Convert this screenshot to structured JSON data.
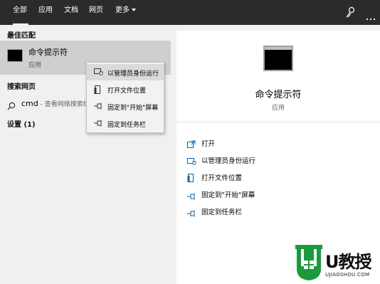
{
  "tabs": {
    "all": "全部",
    "apps": "应用",
    "docs": "文档",
    "web": "网页",
    "more": "更多"
  },
  "left": {
    "best_match_title": "最佳匹配",
    "best_match": {
      "name": "命令提示符",
      "type": "应用",
      "icon": "command-prompt-icon"
    },
    "web_title": "搜索网页",
    "web_query": "cmd",
    "web_hint": " - 查看网络搜索结",
    "settings_title": "设置 (1)"
  },
  "context_menu": [
    {
      "label": "以管理员身份运行",
      "icon": "shield-icon"
    },
    {
      "label": "打开文件位置",
      "icon": "file-location-icon"
    },
    {
      "label": "固定到\"开始\"屏幕",
      "icon": "pin-icon"
    },
    {
      "label": "固定到任务栏",
      "icon": "pin-icon"
    }
  ],
  "right": {
    "name": "命令提示符",
    "type": "应用",
    "actions": [
      {
        "label": "打开",
        "icon": "open-icon"
      },
      {
        "label": "以管理员身份运行",
        "icon": "shield-icon"
      },
      {
        "label": "打开文件位置",
        "icon": "file-location-icon"
      },
      {
        "label": "固定到\"开始\"屏幕",
        "icon": "pin-icon"
      },
      {
        "label": "固定到任务栏",
        "icon": "pin-icon"
      }
    ]
  },
  "watermark": {
    "brand": "U教授",
    "url": "UJIAOSHOU.COM"
  },
  "colors": {
    "topbar": "#2b2b2b",
    "accent": "#0063b1",
    "selection": "#cfcfcf",
    "watermark_green": "#1a9a3b"
  }
}
